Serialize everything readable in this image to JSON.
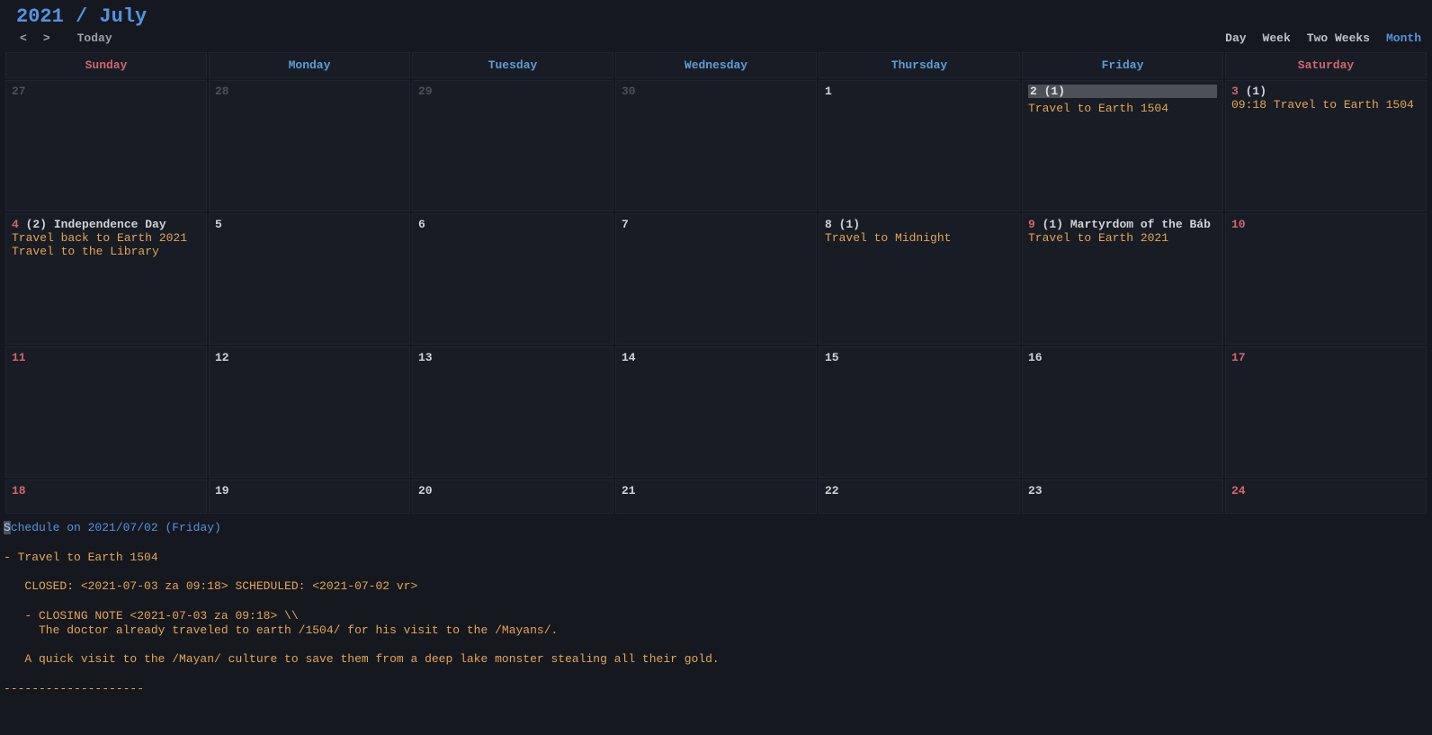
{
  "header": {
    "title": "2021 / July",
    "prev": "<",
    "next": ">",
    "today": "Today"
  },
  "views": {
    "day": "Day",
    "week": "Week",
    "twoweeks": "Two Weeks",
    "month": "Month",
    "active": "month"
  },
  "weekdays": [
    {
      "label": "Sunday",
      "weekend": true
    },
    {
      "label": "Monday",
      "weekend": false
    },
    {
      "label": "Tuesday",
      "weekend": false
    },
    {
      "label": "Wednesday",
      "weekend": false
    },
    {
      "label": "Thursday",
      "weekend": false
    },
    {
      "label": "Friday",
      "weekend": false
    },
    {
      "label": "Saturday",
      "weekend": true
    }
  ],
  "weeks": [
    [
      {
        "num": "27",
        "dim": true
      },
      {
        "num": "28",
        "dim": true
      },
      {
        "num": "29",
        "dim": true
      },
      {
        "num": "30",
        "dim": true
      },
      {
        "num": "1"
      },
      {
        "num": "2",
        "count": "(1)",
        "selected": true,
        "events": [
          "Travel to Earth 1504"
        ]
      },
      {
        "num": "3",
        "weekend": true,
        "count": "(1)",
        "events": [
          "09:18 Travel to Earth 1504"
        ]
      }
    ],
    [
      {
        "num": "4",
        "weekend": true,
        "count": "(2)",
        "holiday": "Independence Day",
        "events": [
          "Travel back to Earth 2021",
          "Travel to the Library"
        ]
      },
      {
        "num": "5"
      },
      {
        "num": "6"
      },
      {
        "num": "7"
      },
      {
        "num": "8",
        "count": "(1)",
        "events": [
          "Travel to Midnight"
        ]
      },
      {
        "num": "9",
        "weekend": true,
        "count": "(1)",
        "holiday": "Martyrdom of the Báb",
        "events": [
          "Travel to Earth 2021"
        ]
      },
      {
        "num": "10",
        "weekend": true
      }
    ],
    [
      {
        "num": "11",
        "weekend": true
      },
      {
        "num": "12"
      },
      {
        "num": "13"
      },
      {
        "num": "14"
      },
      {
        "num": "15"
      },
      {
        "num": "16"
      },
      {
        "num": "17",
        "weekend": true
      }
    ],
    [
      {
        "num": "18",
        "weekend": true
      },
      {
        "num": "19"
      },
      {
        "num": "20"
      },
      {
        "num": "21"
      },
      {
        "num": "22"
      },
      {
        "num": "23"
      },
      {
        "num": "24",
        "weekend": true
      }
    ]
  ],
  "short_last_row": true,
  "detail": {
    "title_prefix_hl": "S",
    "title_rest": "chedule on 2021/07/02 (Friday)",
    "lines": [
      "",
      "- Travel to Earth 1504",
      "",
      "   CLOSED: <2021-07-03 za 09:18> SCHEDULED: <2021-07-02 vr>",
      "",
      "   - CLOSING NOTE <2021-07-03 za 09:18> \\\\",
      "     The doctor already traveled to earth /1504/ for his visit to the /Mayans/.",
      "",
      "   A quick visit to the /Mayan/ culture to save them from a deep lake monster stealing all their gold.",
      "",
      "--------------------"
    ]
  }
}
